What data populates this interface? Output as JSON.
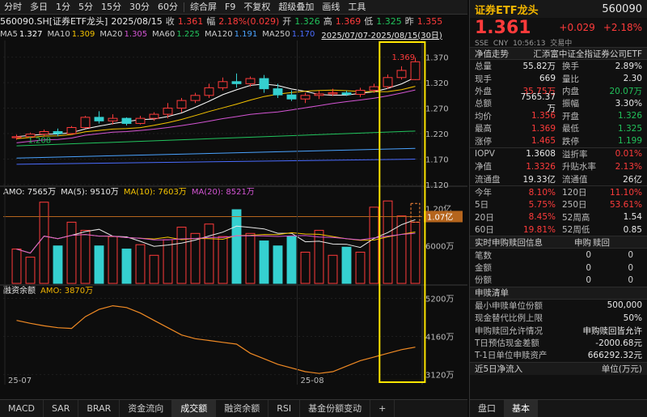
{
  "toolbar": {
    "tabs": [
      "分时",
      "多日",
      "1分",
      "5分",
      "15分",
      "30分",
      "60分"
    ],
    "menu": [
      "综合屏",
      "F9",
      "不复权",
      "超级叠加",
      "画线",
      "工具"
    ]
  },
  "info": {
    "code_name": "560090.SH[证券ETF龙头]",
    "date": "2025/08/15",
    "close_label": "收",
    "close": "1.361",
    "chg_label": "幅",
    "chg": "2.18%(0.029)",
    "open_label": "开",
    "open": "1.326",
    "high_label": "高",
    "high": "1.369",
    "low_label": "低",
    "low": "1.325",
    "pre_label": "昨",
    "pre": "1.355"
  },
  "ma": {
    "items": [
      {
        "label": "MA5",
        "value": "1.327",
        "color": "#ffffff"
      },
      {
        "label": "MA10",
        "value": "1.309",
        "color": "#f5c400"
      },
      {
        "label": "MA20",
        "value": "1.305",
        "color": "#d455d4"
      },
      {
        "label": "MA60",
        "value": "1.225",
        "color": "#22c55e"
      },
      {
        "label": "MA120",
        "value": "1.191",
        "color": "#4aa3ff"
      },
      {
        "label": "MA250",
        "value": "1.170",
        "color": "#4a6cff"
      }
    ],
    "range": "2025/07/07-2025/08/15(30日)"
  },
  "vol": {
    "amo_label": "AMO: 7565万",
    "ma5_label": "MA(5): 9510万",
    "ma10_label": "MA(10): 7603万",
    "ma20_label": "MA(20): 8521万"
  },
  "margin": {
    "title": "融资余额",
    "amo_label": "AMO: 3870万"
  },
  "axis": {
    "price_ticks": [
      "1.370",
      "1.320",
      "1.270",
      "1.220",
      "1.170",
      "1.120"
    ],
    "vol_ticks": [
      "1.20亿",
      "6000万"
    ],
    "vol_marker": "1.07亿",
    "margin_ticks": [
      "5200万",
      "4160万",
      "3120万"
    ],
    "x_ticks": [
      "25-07",
      "25-08"
    ],
    "high_mark": "1.369",
    "low_mark": "1.208"
  },
  "chart_data": {
    "type": "candlestick",
    "ohlc": [
      [
        1.212,
        1.218,
        1.208,
        1.214
      ],
      [
        1.214,
        1.222,
        1.21,
        1.219
      ],
      [
        1.219,
        1.228,
        1.214,
        1.224
      ],
      [
        1.224,
        1.23,
        1.215,
        1.22
      ],
      [
        1.22,
        1.235,
        1.218,
        1.232
      ],
      [
        1.232,
        1.255,
        1.23,
        1.252
      ],
      [
        1.252,
        1.264,
        1.24,
        1.245
      ],
      [
        1.245,
        1.258,
        1.238,
        1.25
      ],
      [
        1.25,
        1.252,
        1.236,
        1.24
      ],
      [
        1.24,
        1.255,
        1.238,
        1.25
      ],
      [
        1.25,
        1.262,
        1.245,
        1.258
      ],
      [
        1.258,
        1.28,
        1.25,
        1.27
      ],
      [
        1.27,
        1.29,
        1.262,
        1.285
      ],
      [
        1.285,
        1.3,
        1.28,
        1.295
      ],
      [
        1.295,
        1.318,
        1.29,
        1.31
      ],
      [
        1.31,
        1.33,
        1.305,
        1.322
      ],
      [
        1.322,
        1.338,
        1.31,
        1.318
      ],
      [
        1.318,
        1.332,
        1.312,
        1.328
      ],
      [
        1.328,
        1.335,
        1.3,
        1.308
      ],
      [
        1.308,
        1.318,
        1.29,
        1.296
      ],
      [
        1.296,
        1.305,
        1.284,
        1.288
      ],
      [
        1.288,
        1.3,
        1.28,
        1.295
      ],
      [
        1.295,
        1.304,
        1.288,
        1.298
      ],
      [
        1.298,
        1.308,
        1.294,
        1.3
      ],
      [
        1.3,
        1.304,
        1.294,
        1.297
      ],
      [
        1.297,
        1.31,
        1.292,
        1.305
      ],
      [
        1.305,
        1.318,
        1.3,
        1.312
      ],
      [
        1.312,
        1.336,
        1.308,
        1.33
      ],
      [
        1.33,
        1.352,
        1.326,
        1.344
      ],
      [
        1.326,
        1.369,
        1.325,
        1.361
      ]
    ],
    "volume": [
      55,
      42,
      130,
      60,
      98,
      85,
      60,
      75,
      55,
      62,
      45,
      70,
      90,
      80,
      95,
      75,
      118,
      80,
      68,
      60,
      75,
      50,
      85,
      45,
      58,
      50,
      122,
      132,
      108,
      98
    ],
    "margin": [
      4600,
      4520,
      4450,
      4400,
      4380,
      4700,
      4900,
      5000,
      4950,
      4800,
      4600,
      4400,
      4200,
      4100,
      4050,
      4000,
      3950,
      3700,
      3550,
      3400,
      3300,
      3200,
      3150,
      3200,
      3350,
      3500,
      3600,
      3700,
      3800,
      3870
    ],
    "ylim": [
      1.12,
      1.39
    ],
    "vol_max": 140,
    "margin_range": [
      3000,
      5300
    ],
    "colors": {
      "up": "#ff3b3b",
      "down": "#35d0d0"
    }
  },
  "right": {
    "title": "证券ETF龙头",
    "code": "560090",
    "price": "1.361",
    "chg": "+0.029",
    "pct": "+2.18%",
    "meta": "SSE  CNY  10:56:13  交易中",
    "net_label": "净值走势",
    "fund_co": "汇添富中证全指证券公司ETF",
    "rows1": [
      [
        "总量",
        "55.82万",
        "换手",
        "2.89%"
      ],
      [
        "现手",
        "669",
        "量比",
        "2.30"
      ],
      [
        "外盘",
        "35.75万",
        "内盘",
        "20.07万"
      ],
      [
        "总额",
        "7565.37万",
        "振幅",
        "3.30%"
      ],
      [
        "均价",
        "1.356",
        "开盘",
        "1.326"
      ],
      [
        "最高",
        "1.369",
        "最低",
        "1.325"
      ],
      [
        "涨停",
        "1.465",
        "跌停",
        "1.199"
      ]
    ],
    "rows2": [
      [
        "IOPV",
        "1.3608",
        "溢折率",
        "0.01%"
      ],
      [
        "净值",
        "1.3326",
        "升贴水率",
        "2.13%"
      ],
      [
        "流通盘",
        "19.33亿",
        "流通值",
        "26亿"
      ]
    ],
    "rows3": [
      [
        "今年",
        "8.10%",
        "120日",
        "11.10%"
      ],
      [
        "5日",
        "5.75%",
        "250日",
        "53.61%"
      ],
      [
        "20日",
        "8.45%",
        "52周高",
        "1.54"
      ],
      [
        "60日",
        "19.81%",
        "52周低",
        "0.85"
      ]
    ],
    "sub_header": [
      "实时申购赎回信息",
      "申购",
      "赎回"
    ],
    "sub_rows": [
      [
        "笔数",
        "0",
        "0"
      ],
      [
        "金额",
        "0",
        "0"
      ],
      [
        "份额",
        "0",
        "0"
      ]
    ],
    "list_header": "申赎清单",
    "list_rows": [
      [
        "最小申赎单位份额",
        "500,000"
      ],
      [
        "现金替代比例上限",
        "50%"
      ],
      [
        "申购赎回允许情况",
        "申购赎回皆允许"
      ],
      [
        "T日预估现金差额",
        "-2000.68元"
      ],
      [
        "T-1日单位申赎资产",
        "666292.32元"
      ]
    ],
    "flow_label": "近5日净流入",
    "flow_unit": "单位(万元)",
    "tabs": [
      "盘口",
      "基本"
    ]
  },
  "bottom_tabs": [
    "MACD",
    "SAR",
    "BRAR",
    "资金流向",
    "成交额",
    "融资余额",
    "RSI",
    "基金份额变动",
    "+"
  ]
}
